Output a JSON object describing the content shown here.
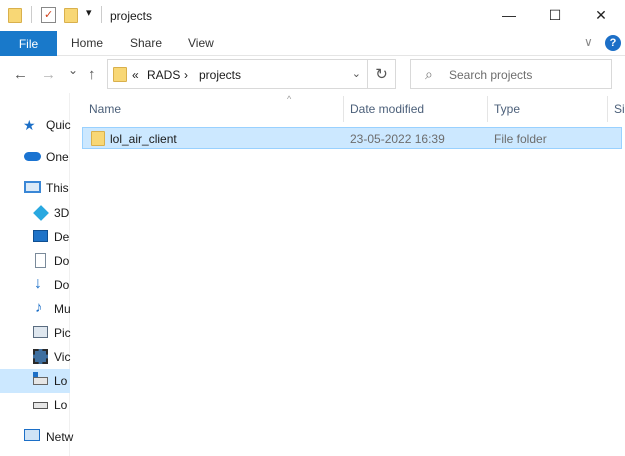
{
  "window": {
    "title": "projects",
    "minimize_glyph": "—",
    "maximize_glyph": "☐",
    "close_glyph": "✕"
  },
  "quick_access": {
    "icons": [
      "folder-icon",
      "properties-icon",
      "new-folder-icon",
      "customize-dropdown-icon"
    ],
    "dropdown_glyph": "▾"
  },
  "ribbon": {
    "file": "File",
    "home": "Home",
    "share": "Share",
    "view": "View",
    "expand_glyph": "∨",
    "help_glyph": "?"
  },
  "nav": {
    "back_glyph": "←",
    "forward_glyph": "→",
    "recent_glyph": "⌄",
    "up_glyph": "↑"
  },
  "address": {
    "overflow": "«",
    "crumbs": [
      "RADS",
      "projects"
    ],
    "separator": "›",
    "dropdown_glyph": "⌄",
    "refresh_glyph": "↻"
  },
  "search": {
    "placeholder": "Search projects",
    "icon": "search-icon"
  },
  "sidebar": {
    "items": [
      {
        "label": "Quic",
        "icon": "quick-access-star-icon",
        "color": "#1c6fc7"
      },
      {
        "label": "One",
        "icon": "onedrive-cloud-icon",
        "color": "#1a73d1"
      },
      {
        "label": "This",
        "icon": "this-pc-icon",
        "color": "#3a87d6"
      },
      {
        "label": "3D",
        "icon": "3d-objects-icon",
        "color": "#29a8e0"
      },
      {
        "label": "De",
        "icon": "desktop-icon",
        "color": "#1e73c8"
      },
      {
        "label": "Do",
        "icon": "documents-icon",
        "color": "#7a8a9a"
      },
      {
        "label": "Do",
        "icon": "downloads-icon",
        "color": "#1c6fc7"
      },
      {
        "label": "Mu",
        "icon": "music-icon",
        "color": "#1c6fc7"
      },
      {
        "label": "Pic",
        "icon": "pictures-icon",
        "color": "#5a6c80"
      },
      {
        "label": "Vic",
        "icon": "videos-icon",
        "color": "#4a4a4a"
      },
      {
        "label": "Lo",
        "icon": "local-disk-windows-icon",
        "color": "#1c6fc7"
      },
      {
        "label": "Lo",
        "icon": "local-disk-icon",
        "color": "#555555"
      },
      {
        "label": "Netw",
        "icon": "network-icon",
        "color": "#1c6fc7"
      }
    ]
  },
  "columns": {
    "name": "Name",
    "date_modified": "Date modified",
    "type": "Type",
    "size": "Si",
    "sort_glyph": "^"
  },
  "files": [
    {
      "name": "lol_air_client",
      "date_modified": "23-05-2022 16:39",
      "type": "File folder"
    }
  ],
  "colors": {
    "accent": "#1979ca",
    "selection": "#cce8ff",
    "selection_border": "#99d1ff",
    "folder": "#f8d775"
  }
}
